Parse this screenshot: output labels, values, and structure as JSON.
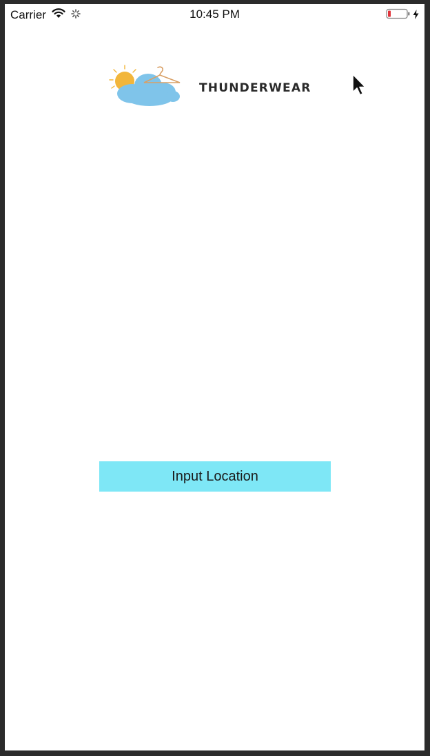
{
  "status_bar": {
    "carrier": "Carrier",
    "time": "10:45 PM",
    "icons": [
      "wifi-icon",
      "activity-spinner-icon",
      "battery-low-icon",
      "charging-bolt-icon"
    ]
  },
  "header": {
    "logo_icon": "weather-cloud-sun-hanger-logo",
    "app_name": "THUNDERWEAR"
  },
  "main": {
    "input_location_label": "Input Location"
  },
  "colors": {
    "button_background": "#7ee7f6",
    "screen_background": "#ffffff",
    "frame": "#2b2b2b",
    "battery_low": "#e0333a",
    "cloud": "#7fc4ea",
    "sun": "#f2b63b"
  }
}
